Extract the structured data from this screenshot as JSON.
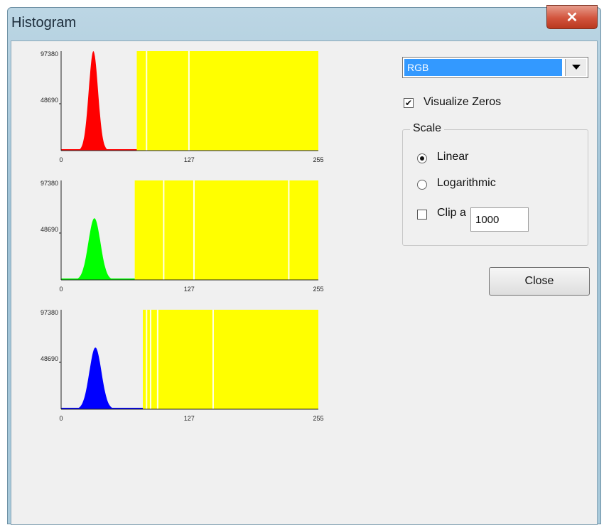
{
  "window": {
    "title": "Histogram",
    "close_glyph": "✕"
  },
  "channel_select": {
    "value": "RGB"
  },
  "visualize_zeros": {
    "label": "Visualize Zeros",
    "checked": true
  },
  "scale": {
    "title": "Scale",
    "linear_label": "Linear",
    "log_label": "Logarithmic",
    "selected": "Linear",
    "clip_label": "Clip a",
    "clip_checked": false,
    "clip_value": "1000"
  },
  "close_button": {
    "label": "Close"
  },
  "histograms": [
    {
      "name": "red",
      "color": "#ff0000",
      "y_max_label": "97380",
      "y_mid_label": "48690",
      "x_labels": [
        "0",
        "127",
        "255"
      ],
      "peak_fraction": 1.0,
      "mean": 32,
      "sigma": 4.6,
      "zero_band_start": 75,
      "gap_bins": [
        84,
        126
      ]
    },
    {
      "name": "green",
      "color": "#00ff00",
      "y_max_label": "97380",
      "y_mid_label": "48690",
      "x_labels": [
        "0",
        "127",
        "255"
      ],
      "peak_fraction": 0.62,
      "mean": 33,
      "sigma": 6,
      "zero_band_start": 73,
      "gap_bins": [
        101,
        131,
        225
      ]
    },
    {
      "name": "blue",
      "color": "#0000ff",
      "y_max_label": "97380",
      "y_mid_label": "48690",
      "x_labels": [
        "0",
        "127",
        "255"
      ],
      "peak_fraction": 0.62,
      "mean": 34,
      "sigma": 6,
      "zero_band_start": 81,
      "gap_bins": [
        84,
        88,
        95,
        150
      ]
    }
  ],
  "colors": {
    "zero_band": "#ffff00",
    "select_highlight": "#3399ff",
    "title_close": "#d2543d"
  }
}
